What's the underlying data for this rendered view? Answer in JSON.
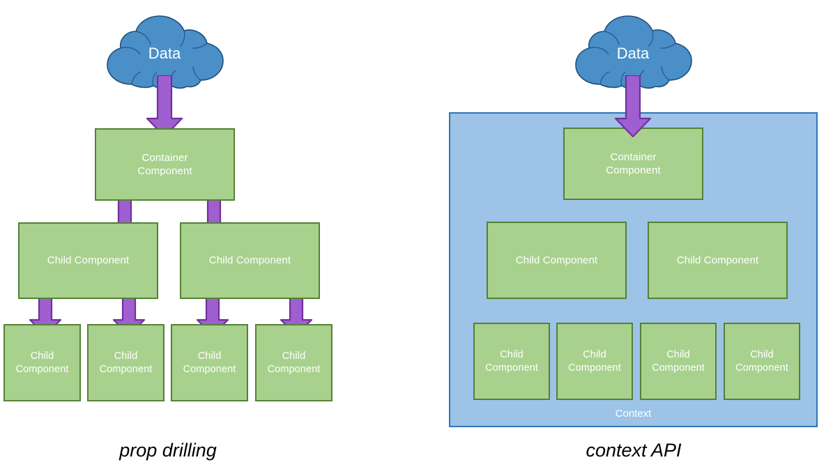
{
  "diagram": {
    "title_left": "prop drilling",
    "title_right": "context API",
    "colors": {
      "component_fill": "#A9D18E",
      "component_border": "#538135",
      "cloud_fill": "#4A8FC8",
      "cloud_border": "#1F4E79",
      "arrow_fill": "#A05FD0",
      "arrow_border": "#7030A0",
      "context_fill": "#9DC3E6",
      "context_border": "#2E75B6",
      "label_text": "#FFFFFF",
      "caption_text": "#000000",
      "background": "#FFFFFF"
    }
  },
  "left_diagram": {
    "caption": "prop drilling",
    "cloud_label": "Data",
    "container": {
      "label": "Container\nComponent"
    },
    "mid_children": [
      {
        "label": "Child Component"
      },
      {
        "label": "Child Component"
      }
    ],
    "leaf_children": [
      {
        "label": "Child\nComponent"
      },
      {
        "label": "Child\nComponent"
      },
      {
        "label": "Child\nComponent"
      },
      {
        "label": "Child\nComponent"
      }
    ],
    "arrows": [
      {
        "name": "data-to-container"
      },
      {
        "name": "container-to-child-1"
      },
      {
        "name": "container-to-child-2"
      },
      {
        "name": "child1-to-leaf-1"
      },
      {
        "name": "child1-to-leaf-2"
      },
      {
        "name": "child2-to-leaf-3"
      },
      {
        "name": "child2-to-leaf-4"
      }
    ]
  },
  "right_diagram": {
    "caption": "context API",
    "cloud_label": "Data",
    "context_label": "Context",
    "container": {
      "label": "Container\nComponent"
    },
    "mid_children": [
      {
        "label": "Child Component"
      },
      {
        "label": "Child Component"
      }
    ],
    "leaf_children": [
      {
        "label": "Child\nComponent"
      },
      {
        "label": "Child\nComponent"
      },
      {
        "label": "Child\nComponent"
      },
      {
        "label": "Child\nComponent"
      }
    ],
    "arrows": [
      {
        "name": "data-to-container"
      }
    ]
  }
}
